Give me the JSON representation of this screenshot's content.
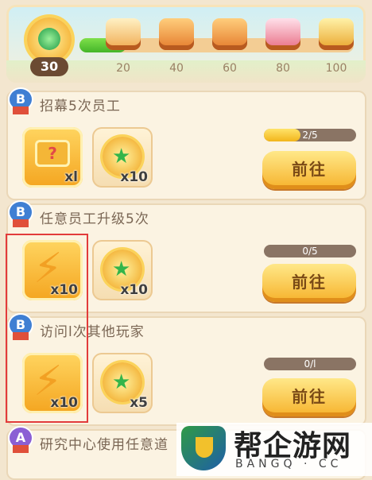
{
  "top": {
    "level": "30",
    "progress_fraction": 0.17,
    "milestones": [
      {
        "label": "20",
        "icon": "chest-open-icon"
      },
      {
        "label": "40",
        "icon": "chest-icon"
      },
      {
        "label": "60",
        "icon": "chest-icon"
      },
      {
        "label": "80",
        "icon": "pink-chest-icon"
      },
      {
        "label": "100",
        "icon": "gold-chest-icon"
      }
    ]
  },
  "tasks": [
    {
      "badge": "B",
      "title": "招幕5次员工",
      "rewards": [
        {
          "icon": "ticket-icon",
          "qty": "xl"
        },
        {
          "icon": "star-coin-icon",
          "qty": "x10"
        }
      ],
      "progress_text": "2/5",
      "progress_fraction": 0.4,
      "button": "前往"
    },
    {
      "badge": "B",
      "title": "任意员工升级5次",
      "rewards": [
        {
          "icon": "lightning-icon",
          "qty": "x10"
        },
        {
          "icon": "star-coin-icon",
          "qty": "x10"
        }
      ],
      "progress_text": "0/5",
      "progress_fraction": 0,
      "button": "前往"
    },
    {
      "badge": "B",
      "title": "访问l次其他玩家",
      "rewards": [
        {
          "icon": "lightning-icon",
          "qty": "x10"
        },
        {
          "icon": "star-coin-icon",
          "qty": "x5"
        }
      ],
      "progress_text": "0/l",
      "progress_fraction": 0,
      "button": "前往"
    },
    {
      "badge": "A",
      "title": "研究中心使用任意道"
    }
  ],
  "watermark": {
    "name": "帮企游网",
    "domain": "BANGQ · CC"
  },
  "colors": {
    "accent": "#f6b22b",
    "highlight_box": "#e23b3b",
    "progress_green": "#44b52a"
  }
}
